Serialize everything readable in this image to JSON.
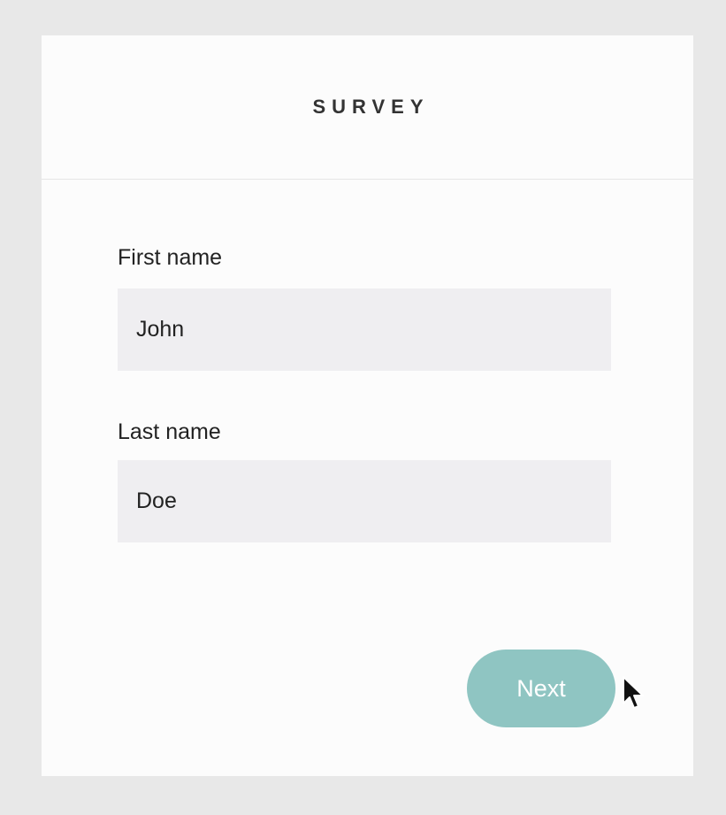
{
  "survey": {
    "title": "SURVEY",
    "fields": [
      {
        "label": "First name",
        "value": "John"
      },
      {
        "label": "Last name",
        "value": "Doe"
      }
    ],
    "next_label": "Next"
  },
  "colors": {
    "page_background": "#e8e8e8",
    "card_background": "#fcfcfc",
    "input_background": "#efeef1",
    "button_background": "#8fc5c2",
    "button_text": "#ffffff"
  },
  "icons": {
    "cursor": "mouse-pointer-icon"
  }
}
